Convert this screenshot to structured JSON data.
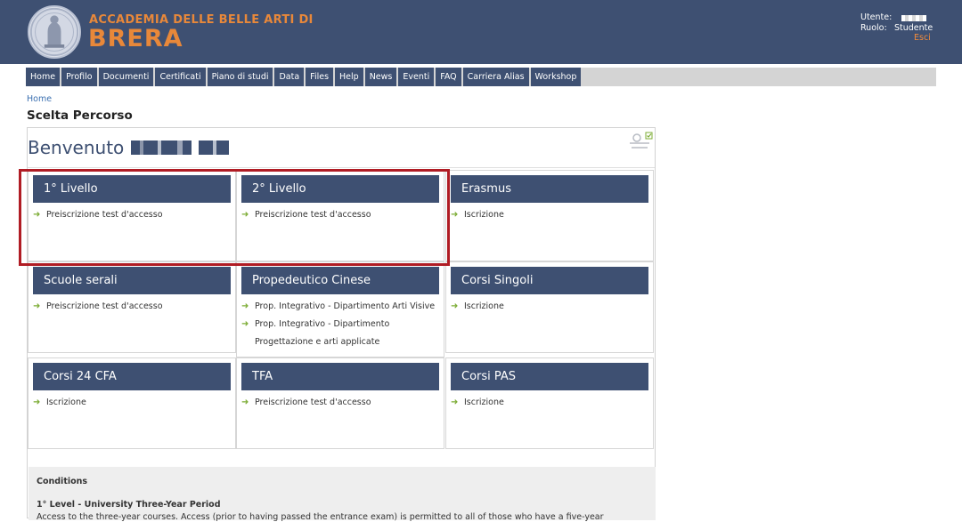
{
  "header": {
    "brand_top": "ACCADEMIA DELLE BELLE ARTI DI",
    "brand_main": "BRERA",
    "user_label": "Utente:",
    "role_label": "Ruolo:",
    "role_value": "Studente",
    "logout": "Esci"
  },
  "nav": [
    "Home",
    "Profilo",
    "Documenti",
    "Certificati",
    "Piano di studi",
    "Data",
    "Files",
    "Help",
    "News",
    "Eventi",
    "FAQ",
    "Carriera Alias",
    "Workshop"
  ],
  "breadcrumb": "Home",
  "page_title": "Scelta Percorso",
  "welcome": "Benvenuto",
  "cards": [
    {
      "title": "1° Livello",
      "links": [
        [
          "Preiscrizione test d'accesso"
        ]
      ]
    },
    {
      "title": "2° Livello",
      "links": [
        [
          "Preiscrizione test d'accesso"
        ]
      ]
    },
    {
      "title": "Erasmus",
      "links": [
        [
          "Iscrizione"
        ]
      ]
    },
    {
      "title": "Scuole serali",
      "links": [
        [
          "Preiscrizione test d'accesso"
        ]
      ]
    },
    {
      "title": "Propedeutico Cinese",
      "links": [
        [
          "Prop. Integrativo - Dipartimento Arti Visive"
        ],
        [
          "Prop. Integrativo - Dipartimento",
          "Progettazione e arti applicate"
        ]
      ]
    },
    {
      "title": "Corsi Singoli",
      "links": [
        [
          "Iscrizione"
        ]
      ]
    },
    {
      "title": "Corsi 24 CFA",
      "links": [
        [
          "Iscrizione"
        ]
      ]
    },
    {
      "title": "TFA",
      "links": [
        [
          "Preiscrizione test d'accesso"
        ]
      ]
    },
    {
      "title": "Corsi PAS",
      "links": [
        [
          "Iscrizione"
        ]
      ]
    }
  ],
  "conditions": {
    "title": "Conditions",
    "subtitle": "1° Level - University Three-Year Period",
    "text": "Access to the three-year courses. Access (prior to having passed the entrance exam) is permitted to all of those who have a five-year"
  },
  "colors": {
    "header": "#3e5072",
    "brand": "#e8883a",
    "highlight": "#b01c24",
    "arrow": "#7cac35"
  }
}
